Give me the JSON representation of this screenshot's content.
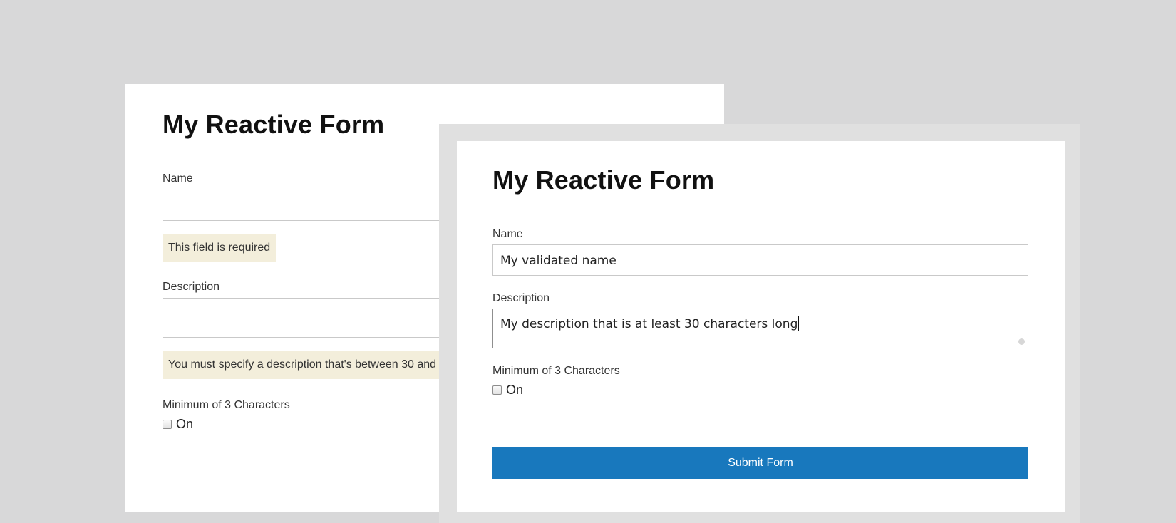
{
  "back_form": {
    "title": "My Reactive Form",
    "name_label": "Name",
    "name_value": "",
    "name_error": "This field is required",
    "description_label": "Description",
    "description_value": "",
    "description_error": "You must specify a description that's between 30 and",
    "checkbox_label": "Minimum of 3 Characters",
    "checkbox_option": "On",
    "checkbox_checked": false
  },
  "front_form": {
    "title": "My Reactive Form",
    "name_label": "Name",
    "name_value": "My validated name",
    "description_label": "Description",
    "description_value": "My description that is at least 30 characters long",
    "checkbox_label": "Minimum of 3 Characters",
    "checkbox_option": "On",
    "checkbox_checked": false,
    "submit_label": "Submit Form"
  },
  "colors": {
    "background": "#d8d8d9",
    "error_background": "#f3eedb",
    "submit_background": "#1878bd"
  }
}
